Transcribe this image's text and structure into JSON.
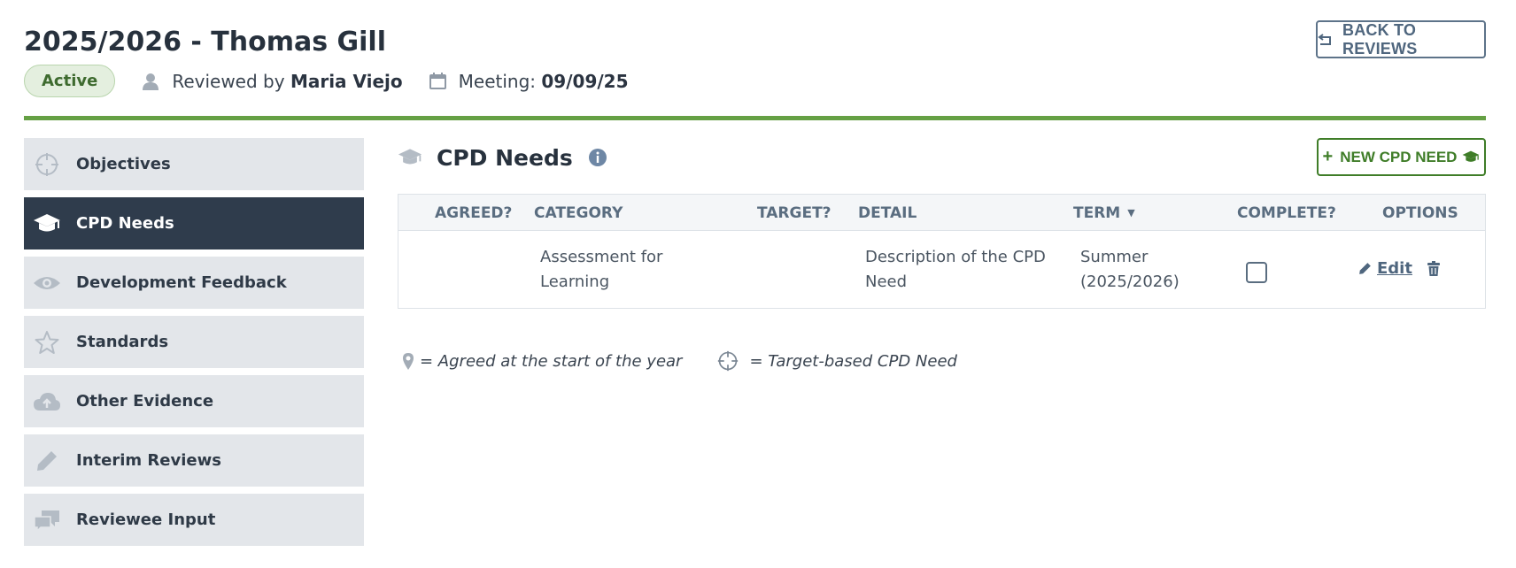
{
  "header": {
    "title": "2025/2026 - Thomas Gill",
    "status": "Active",
    "reviewed_by_label": "Reviewed by",
    "reviewer": "Maria Viejo",
    "meeting_label": "Meeting:",
    "meeting_date": "09/09/25",
    "back_button": "BACK TO REVIEWS"
  },
  "colors": {
    "accent_green": "#65a044",
    "sidebar_active": "#2f3c4c",
    "sidebar_bg": "#e3e6ea"
  },
  "sidebar": {
    "items": [
      {
        "label": "Objectives",
        "icon": "crosshair-icon",
        "active": false
      },
      {
        "label": "CPD Needs",
        "icon": "graduation-cap-icon",
        "active": true
      },
      {
        "label": "Development Feedback",
        "icon": "eye-icon",
        "active": false
      },
      {
        "label": "Standards",
        "icon": "star-icon",
        "active": false
      },
      {
        "label": "Other Evidence",
        "icon": "cloud-upload-icon",
        "active": false
      },
      {
        "label": "Interim Reviews",
        "icon": "pencil-icon",
        "active": false
      },
      {
        "label": "Reviewee Input",
        "icon": "chat-bubbles-icon",
        "active": false
      }
    ]
  },
  "main": {
    "section_title": "CPD Needs",
    "new_button": "NEW CPD NEED",
    "new_button_plus": "+",
    "table": {
      "columns": [
        "AGREED?",
        "CATEGORY",
        "TARGET?",
        "DETAIL",
        "TERM",
        "COMPLETE?",
        "OPTIONS"
      ],
      "sort_indicator": "▼",
      "rows": [
        {
          "agreed": "",
          "category_line1": "Assessment for",
          "category_line2": "Learning",
          "target": "",
          "detail_line1": "Description of the CPD",
          "detail_line2": "Need",
          "term_line1": "Summer",
          "term_line2": "(2025/2026)",
          "complete": false,
          "edit_label": "Edit"
        }
      ]
    },
    "legend": {
      "agreed_text": "= Agreed at the start of the year",
      "target_text": "= Target-based CPD Need"
    }
  }
}
